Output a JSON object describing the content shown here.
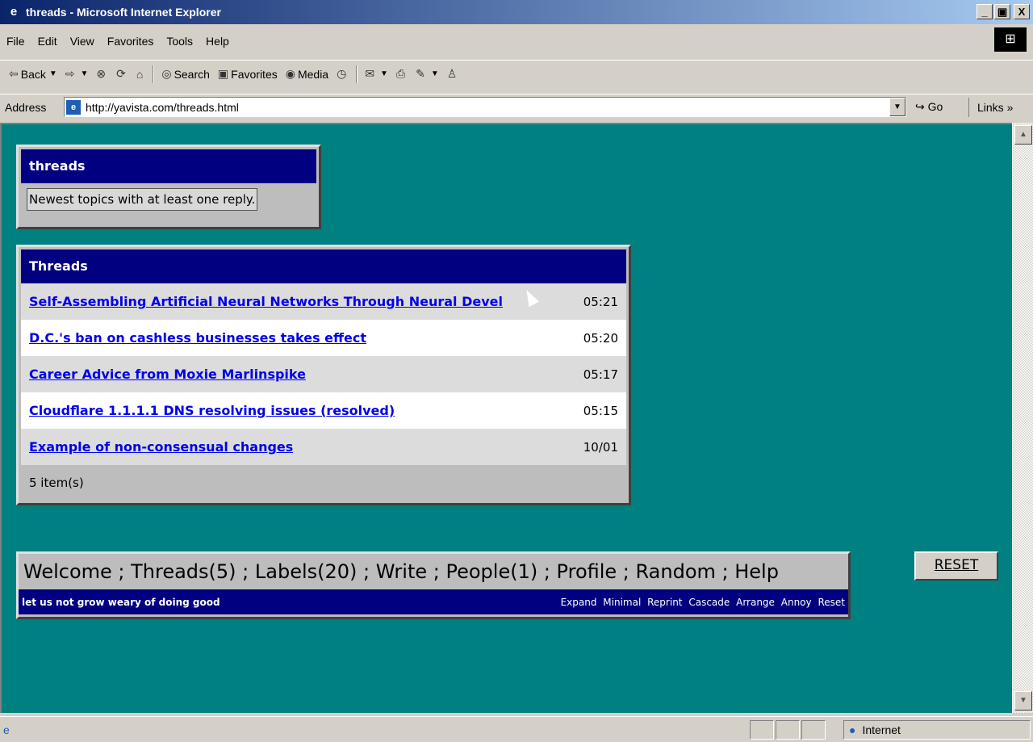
{
  "window": {
    "title": "threads - Microsoft Internet Explorer",
    "minimize": "_",
    "maximize": "▣",
    "close": "X",
    "app_icon": "ie-icon"
  },
  "menu": {
    "items": [
      "File",
      "Edit",
      "View",
      "Favorites",
      "Tools",
      "Help"
    ]
  },
  "toolbar": {
    "back": "Back",
    "search": "Search",
    "favorites": "Favorites",
    "media": "Media"
  },
  "address": {
    "label": "Address",
    "url": "http://yavista.com/threads.html",
    "go": "Go",
    "links": "Links"
  },
  "statusbar": {
    "zone": "Internet"
  },
  "page": {
    "header_box": {
      "title": "threads",
      "description": "Newest topics with at least one reply."
    },
    "threads_box": {
      "title": "Threads",
      "rows": [
        {
          "title": "Self-Assembling Artificial Neural Networks Through Neural Devel",
          "time": "05:21"
        },
        {
          "title": "D.C.'s ban on cashless businesses takes effect",
          "time": "05:20"
        },
        {
          "title": "Career Advice from Moxie Marlinspike",
          "time": "05:17"
        },
        {
          "title": "Cloudflare 1.1.1.1 DNS resolving issues (resolved)",
          "time": "05:15"
        },
        {
          "title": "Example of non-consensual changes",
          "time": "10/01"
        }
      ],
      "count": "5 item(s)"
    },
    "nav": {
      "links": [
        "Welcome",
        "Threads(5)",
        "Labels(20)",
        "Write",
        "People(1)",
        "Profile",
        "Random",
        "Help"
      ],
      "separator": " ; ",
      "motto": "let us not grow weary of doing good",
      "actions": [
        "Expand",
        "Minimal",
        "Reprint",
        "Cascade",
        "Arrange",
        "Annoy",
        "Reset"
      ]
    },
    "reset_button": "RESET"
  }
}
